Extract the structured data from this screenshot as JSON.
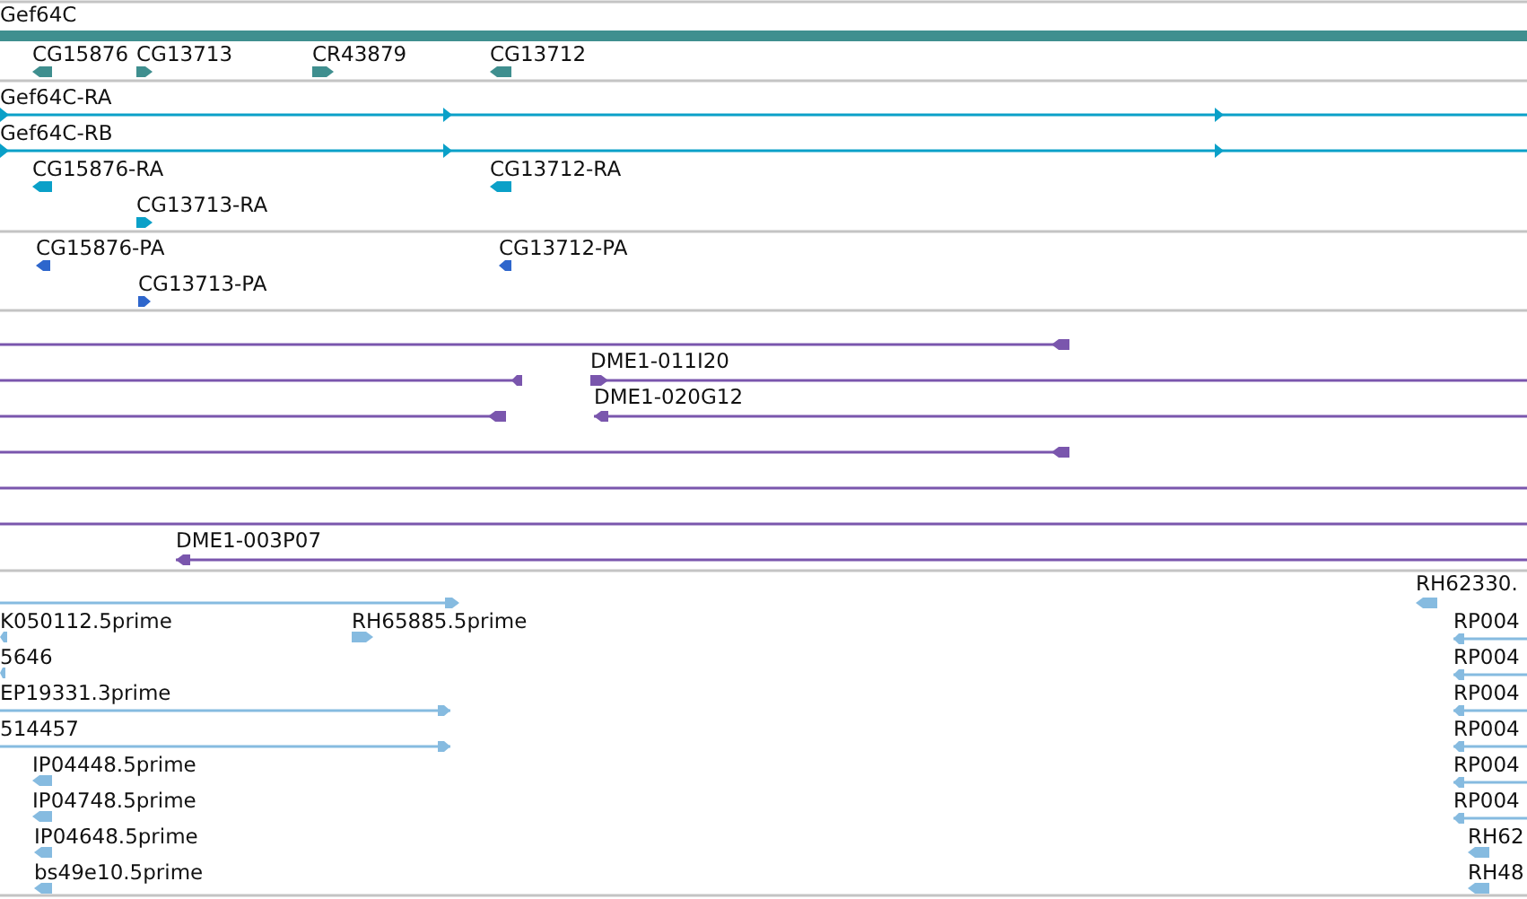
{
  "tracks": [
    {
      "kind": "gene",
      "features": [
        {
          "kind": "bar",
          "label": "Gef64C"
        },
        {
          "kind": "block",
          "label": "CG15876",
          "reverse": true
        },
        {
          "kind": "block",
          "label": "CG13713",
          "reverse": false
        },
        {
          "kind": "block",
          "label": "CR43879",
          "reverse": false
        },
        {
          "kind": "block",
          "label": "CG13712",
          "reverse": true
        }
      ]
    },
    {
      "kind": "transcript",
      "features": [
        {
          "kind": "line",
          "label": "Gef64C-RA",
          "reverse": false
        },
        {
          "kind": "line",
          "label": "Gef64C-RB",
          "reverse": false
        },
        {
          "kind": "block",
          "label": "CG15876-RA",
          "reverse": true
        },
        {
          "kind": "block",
          "label": "CG13712-RA",
          "reverse": true
        },
        {
          "kind": "block",
          "label": "CG13713-RA",
          "reverse": false
        }
      ]
    },
    {
      "kind": "protein",
      "features": [
        {
          "kind": "block",
          "label": "CG15876-PA",
          "reverse": true
        },
        {
          "kind": "block",
          "label": "CG13712-PA",
          "reverse": true
        },
        {
          "kind": "block",
          "label": "CG13713-PA",
          "reverse": false
        }
      ]
    },
    {
      "kind": "clone",
      "features": [
        {
          "kind": "line",
          "reverse": true
        },
        {
          "kind": "line",
          "reverse": true
        },
        {
          "kind": "line",
          "label": "DME1-011I20",
          "reverse": false
        },
        {
          "kind": "line",
          "reverse": true
        },
        {
          "kind": "line",
          "label": "DME1-020G12",
          "reverse": true
        },
        {
          "kind": "line",
          "reverse": true
        },
        {
          "kind": "line"
        },
        {
          "kind": "line"
        },
        {
          "kind": "line",
          "label": "DME1-003P07",
          "reverse": true
        }
      ]
    },
    {
      "kind": "est",
      "features": [
        {
          "kind": "line",
          "reverse": false
        },
        {
          "kind": "block",
          "label": "RH62330.",
          "reverse": true
        },
        {
          "kind": "block",
          "label": "K050112.5prime",
          "reverse": true
        },
        {
          "kind": "block",
          "label": "RH65885.5prime",
          "reverse": false
        },
        {
          "kind": "line",
          "label": "RP004",
          "reverse": true
        },
        {
          "kind": "block",
          "label": "5646",
          "reverse": true
        },
        {
          "kind": "line",
          "label": "RP004",
          "reverse": true
        },
        {
          "kind": "line",
          "label": "EP19331.3prime",
          "reverse": false
        },
        {
          "kind": "line",
          "label": "RP004",
          "reverse": true
        },
        {
          "kind": "line",
          "label": "514457",
          "reverse": false
        },
        {
          "kind": "line",
          "label": "RP004",
          "reverse": true
        },
        {
          "kind": "block",
          "label": "IP04448.5prime",
          "reverse": true
        },
        {
          "kind": "line",
          "label": "RP004",
          "reverse": true
        },
        {
          "kind": "block",
          "label": "IP04748.5prime",
          "reverse": true
        },
        {
          "kind": "line",
          "label": "RP004",
          "reverse": true
        },
        {
          "kind": "block",
          "label": "IP04648.5prime",
          "reverse": true
        },
        {
          "kind": "block",
          "label": "RH62",
          "reverse": true
        },
        {
          "kind": "block",
          "label": "bs49e10.5prime",
          "reverse": true
        },
        {
          "kind": "block",
          "label": "RH48",
          "reverse": true
        }
      ]
    }
  ]
}
